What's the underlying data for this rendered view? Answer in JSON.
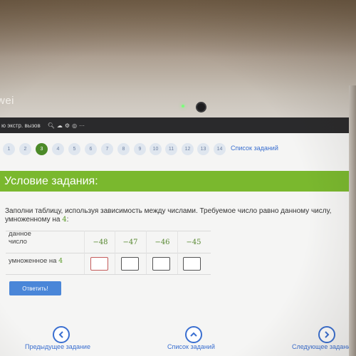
{
  "device": {
    "brand_text": "wei"
  },
  "browser": {
    "tab_text": "ю экстр. вызов",
    "icons": [
      "search-icon",
      "cloud-icon",
      "extension-icon",
      "instagram-icon",
      "more-icon"
    ]
  },
  "nav": {
    "numbers": [
      "1",
      "2",
      "3",
      "4",
      "5",
      "6",
      "7",
      "8",
      "9",
      "10",
      "11",
      "12",
      "13",
      "14"
    ],
    "active_index": 2,
    "task_list_label": "Список заданий"
  },
  "banner": {
    "title": "Условие задания:"
  },
  "task": {
    "line1": "Заполни таблицу, используя зависимость между числами. Требуемое число равно данному числу,",
    "line2_prefix": "умноженному на ",
    "multiplier": "4",
    "line2_suffix": ":"
  },
  "table": {
    "row1_label_line1": "данное",
    "row1_label_line2": "число",
    "row2_label_prefix": "умноженное на ",
    "row2_multiplier": "4",
    "values": [
      "−48",
      "−47",
      "−46",
      "−45"
    ],
    "answers": [
      "",
      "",
      "",
      ""
    ]
  },
  "submit_label": "Ответить!",
  "footer": {
    "prev_label": "Предыдущее задание",
    "list_label": "Список заданий",
    "next_label": "Следующее задание"
  },
  "colors": {
    "banner": "#7ab82e",
    "active_step": "#4c8a28",
    "link": "#3a6fd0",
    "button": "#4a86d8"
  }
}
